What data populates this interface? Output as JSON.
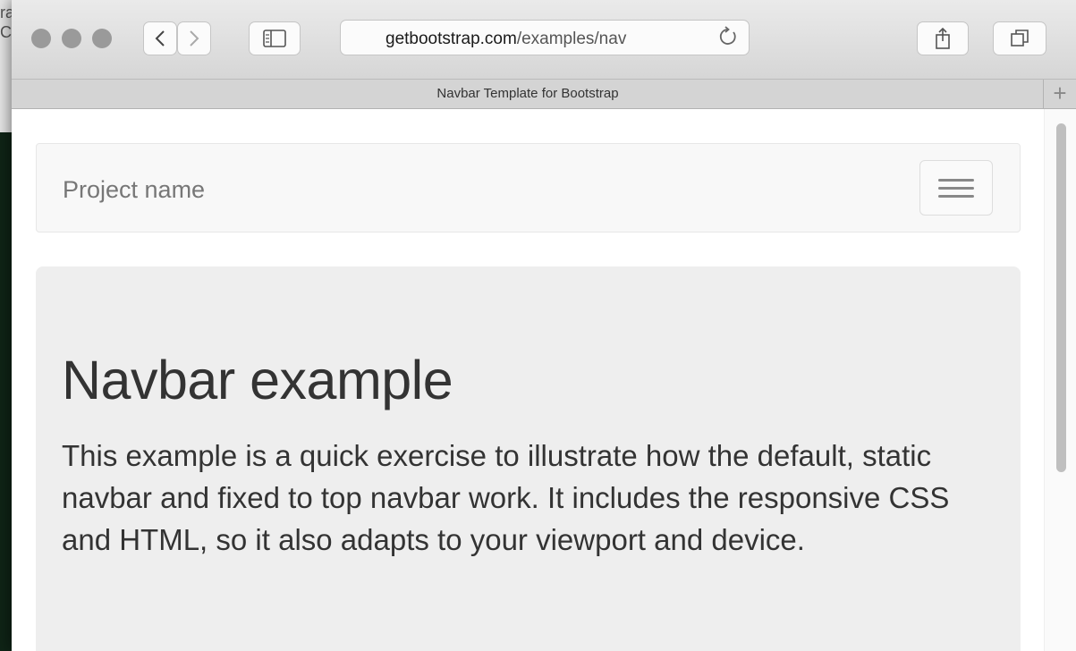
{
  "background": {
    "left_text_top": "ra",
    "left_text_bottom": "C"
  },
  "browser": {
    "url_host": "getbootstrap.com",
    "url_path": "/examples/nav",
    "tab_title": "Navbar Template for Bootstrap",
    "new_tab_label": "+",
    "icons": [
      "back-icon",
      "forward-icon",
      "sidebar-icon",
      "reload-icon",
      "share-icon",
      "tabs-overview-icon"
    ]
  },
  "page": {
    "brand": "Project name",
    "heading": "Navbar example",
    "description": "This example is a quick exercise to illustrate how the default, static navbar and fixed to top navbar work. It includes the responsive CSS and HTML, so it also adapts to your viewport and device."
  },
  "colors": {
    "page_bg": "#ffffff",
    "navbar_bg": "#f8f8f8",
    "jumbotron_bg": "#eeeeee",
    "text": "#333333",
    "brand_text": "#777777"
  }
}
